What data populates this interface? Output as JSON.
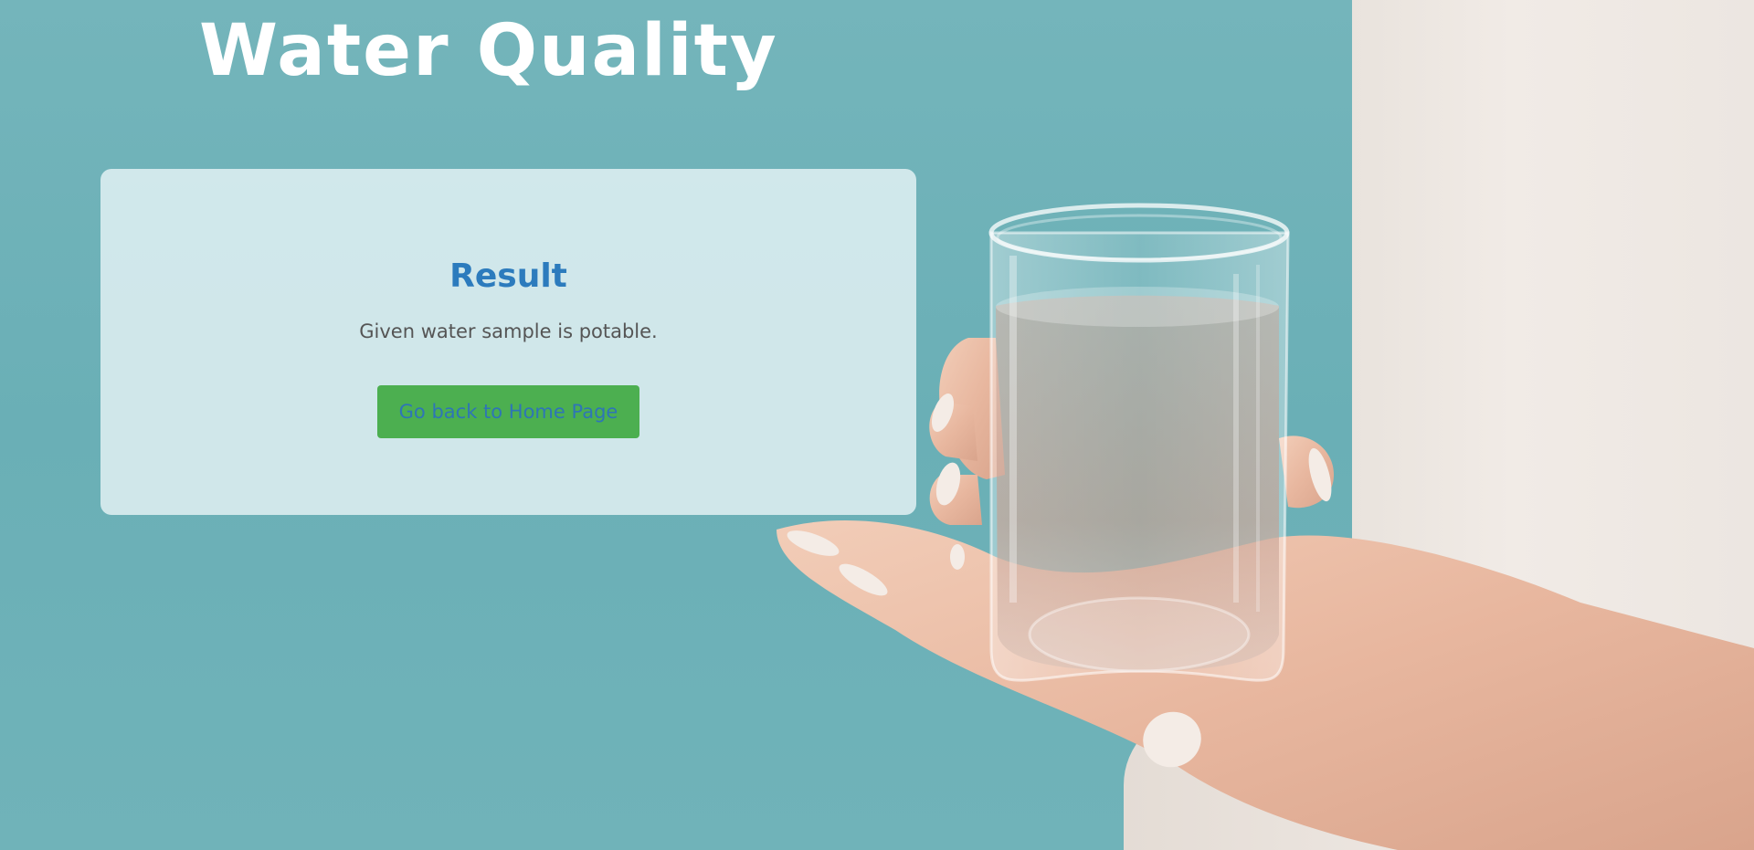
{
  "header": {
    "title": "Water Quality"
  },
  "result_card": {
    "heading": "Result",
    "message": "Given water sample is potable.",
    "home_button_label": "Go back to Home Page"
  },
  "colors": {
    "background": "#6fb2b8",
    "card_background": "#e2f1f3",
    "heading": "#2c7bbd",
    "message": "#555555",
    "button_background": "#4caf50",
    "button_text": "#2e75b6",
    "title": "#ffffff"
  },
  "illustration": {
    "subject": "hand-holding-water-glass"
  }
}
